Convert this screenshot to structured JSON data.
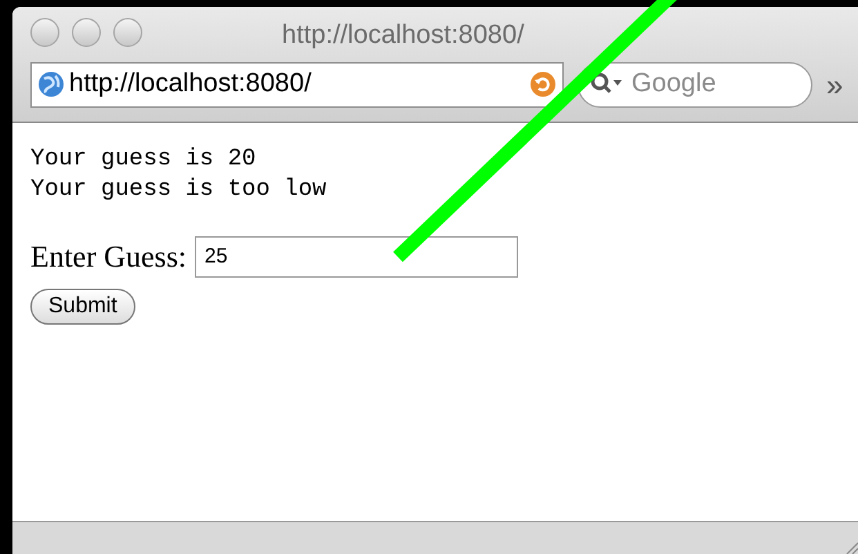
{
  "window": {
    "title": "http://localhost:8080/"
  },
  "toolbar": {
    "address": "http://localhost:8080/",
    "search": {
      "placeholder": "Google"
    },
    "overflow": "»"
  },
  "page": {
    "messages": [
      "Your guess is 20",
      "Your guess is too low"
    ],
    "form": {
      "label": "Enter Guess:",
      "value": "25",
      "button": "Submit"
    }
  }
}
